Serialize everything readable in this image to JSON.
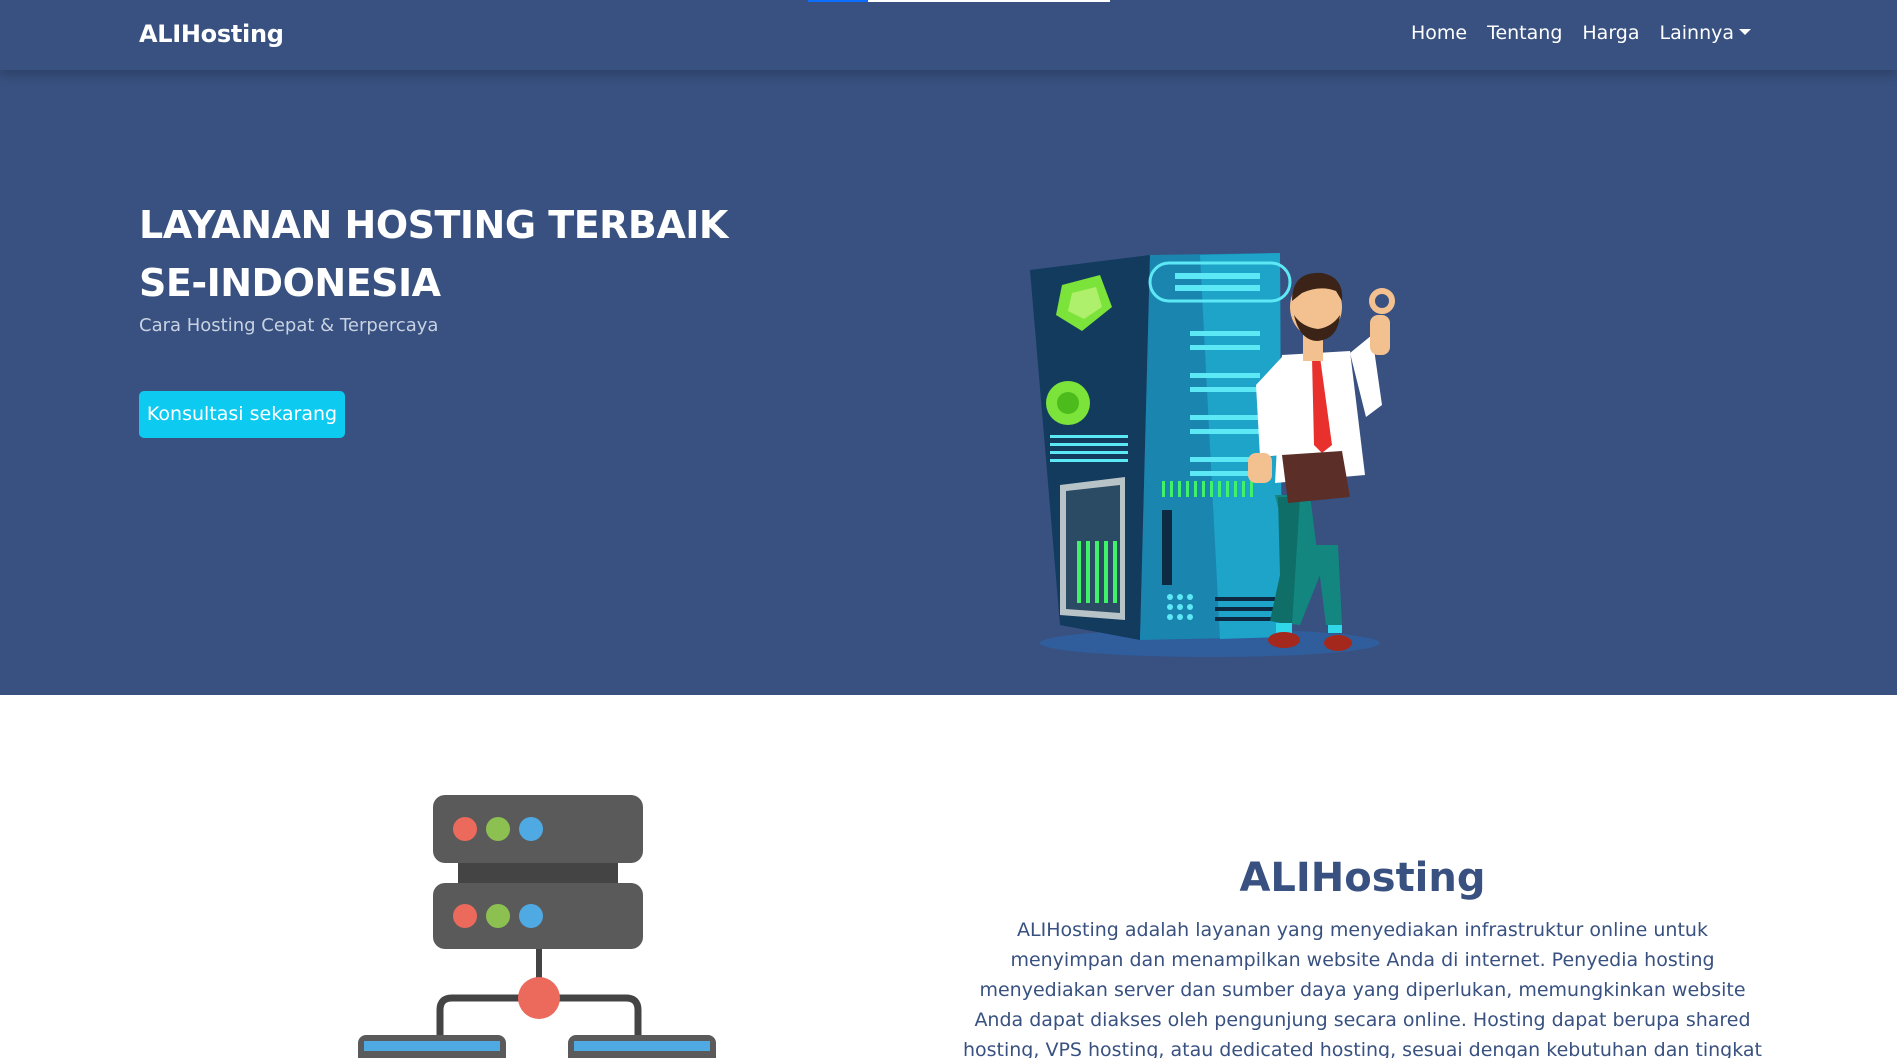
{
  "navbar": {
    "brand": "ALIHosting",
    "items": [
      {
        "label": "Home"
      },
      {
        "label": "Tentang"
      },
      {
        "label": "Harga"
      },
      {
        "label": "Lainnya"
      }
    ]
  },
  "hero": {
    "title": "LAYANAN HOSTING TERBAIK SE-INDONESIA",
    "subtitle": "Cara Hosting Cepat & Terpercaya",
    "cta_label": "Konsultasi sekarang"
  },
  "about": {
    "title": "ALIHosting",
    "text": "ALIHosting adalah layanan yang menyediakan infrastruktur online untuk menyimpan dan menampilkan website Anda di internet. Penyedia hosting menyediakan server dan sumber daya yang diperlukan, memungkinkan website Anda dapat diakses oleh pengunjung secara online. Hosting dapat berupa shared hosting, VPS hosting, atau dedicated hosting, sesuai dengan kebutuhan dan tingkat skala website Anda."
  },
  "colors": {
    "primary": "#385180",
    "cta": "#0dcaf0"
  }
}
